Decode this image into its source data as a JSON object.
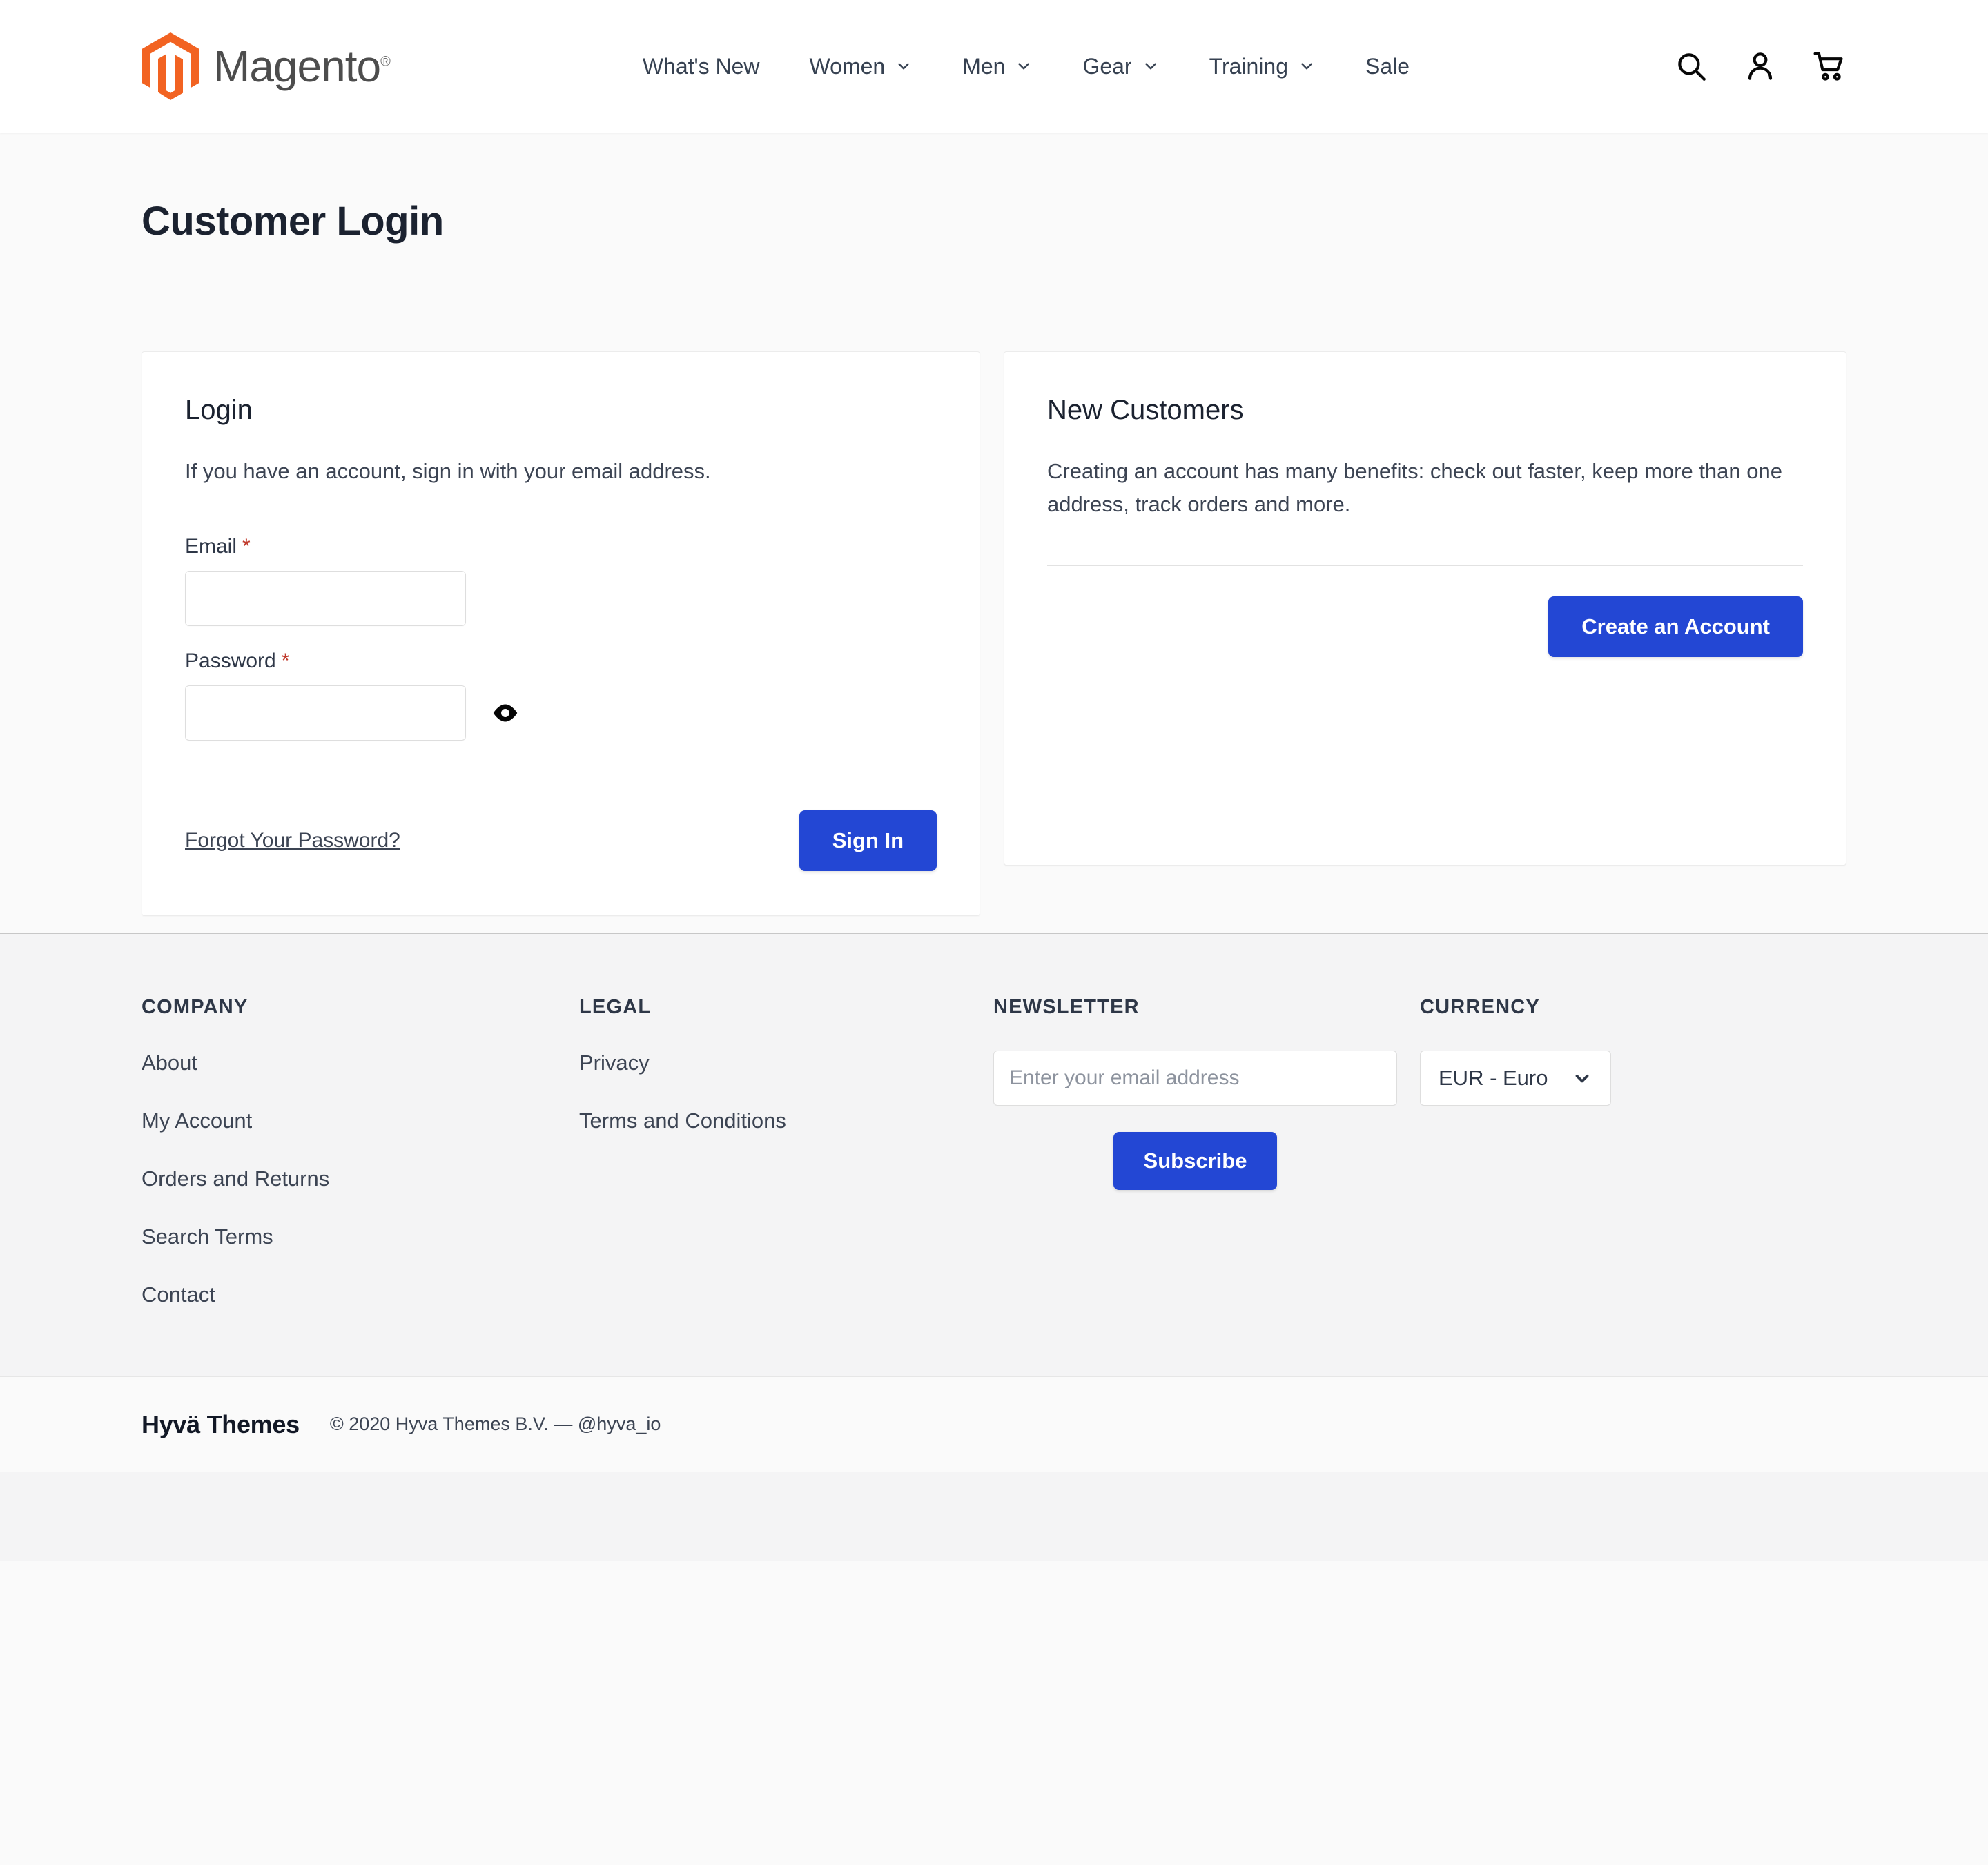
{
  "header": {
    "logo_text": "Magento",
    "logo_registered": "®",
    "nav": [
      {
        "label": "What's New",
        "has_caret": false
      },
      {
        "label": "Women",
        "has_caret": true
      },
      {
        "label": "Men",
        "has_caret": true
      },
      {
        "label": "Gear",
        "has_caret": true
      },
      {
        "label": "Training",
        "has_caret": true
      },
      {
        "label": "Sale",
        "has_caret": false
      }
    ],
    "actions": [
      {
        "icon": "search-icon"
      },
      {
        "icon": "user-account-icon"
      },
      {
        "icon": "shopping-cart-icon"
      }
    ]
  },
  "main": {
    "page_title": "Customer Login",
    "login_card": {
      "heading": "Login",
      "subtitle": "If you have an account, sign in with your email address.",
      "email_label": "Email",
      "email_required": "*",
      "email_value": "",
      "email_placeholder": "",
      "password_label": "Password",
      "password_required": "*",
      "password_value": "",
      "password_placeholder": "",
      "toggle_password_icon": "eye-icon",
      "forgot_link": "Forgot Your Password?",
      "sign_in_label": "Sign In"
    },
    "new_customers_card": {
      "heading": "New Customers",
      "description": "Creating an account has many benefits: check out faster, keep more than one address, track orders and more.",
      "create_account_label": "Create an Account"
    }
  },
  "footer": {
    "company": {
      "title": "COMPANY",
      "links": [
        "About",
        "My Account",
        "Orders and Returns",
        "Search Terms",
        "Contact"
      ]
    },
    "legal": {
      "title": "LEGAL",
      "links": [
        "Privacy",
        "Terms and Conditions"
      ]
    },
    "newsletter": {
      "title": "NEWSLETTER",
      "input_value": "",
      "input_placeholder": "Enter your email address",
      "subscribe_label": "Subscribe"
    },
    "currency": {
      "title": "CURRENCY",
      "selected": "EUR - Euro",
      "caret_icon": "chevron-down-icon"
    },
    "bottom": {
      "brand": "Hyvä Themes",
      "copyright": "© 2020 Hyva Themes B.V.  —   @hyva_io"
    }
  },
  "colors": {
    "accent_blue": "#2347d4",
    "logo_orange": "#f26322",
    "required_red": "#c0392b",
    "page_bg": "#fafafa",
    "footer_bg": "#f4f4f5",
    "text_dark": "#1b2230"
  }
}
